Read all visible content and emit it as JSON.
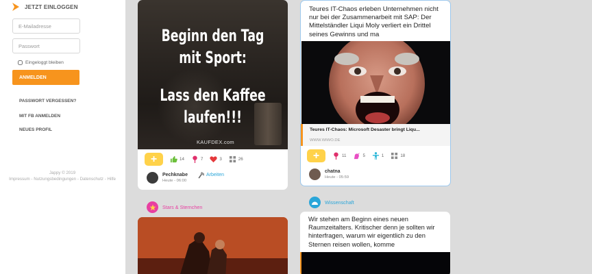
{
  "sidebar": {
    "login_title": "JETZT EINLOGGEN",
    "email_placeholder": "E-Mailadresse",
    "password_placeholder": "Passwort",
    "remember_label": "Eingeloggt bleiben",
    "login_button": "ANMELDEN",
    "links": {
      "forgot": "PASSWORT VERGESSEN?",
      "facebook": "MIT FB ANMELDEN",
      "new_profile": "NEUES PROFIL"
    },
    "footer": {
      "copyright": "Jappy © 2019",
      "links": "Impressum - Nutzungsbedingungen - Datenschutz - Hilfe"
    }
  },
  "feed": {
    "card1": {
      "quote_lines_1": [
        "Beginn den Tag",
        "mit Sport:"
      ],
      "quote_lines_2": [
        "Lass den Kaffee",
        "laufen!!!"
      ],
      "watermark": "KAUFDEX.com",
      "reactions": [
        {
          "icon": "thumbs-up-icon",
          "count": "14",
          "color": "#6bbf3a"
        },
        {
          "icon": "pin-icon",
          "count": "7",
          "color": "#e0306c"
        },
        {
          "icon": "heart-icon",
          "count": "3",
          "color": "#e5393c"
        },
        {
          "icon": "grid-icon",
          "count": "26",
          "color": "#8a8a8a"
        }
      ],
      "author": "Pechknabe",
      "time": "Heute - 06:00",
      "category": "Arbeiten"
    },
    "card2": {
      "text": "Teures IT-Chaos erleben Unternehmen nicht nur bei der Zusammenarbeit mit SAP: Der Mittelständler Liqui Moly verliert ein Drittel seines Gewinns und ma",
      "link_title": "Teures IT-Chaos: Microsoft Desaster bringt Liqu...",
      "link_domain": "WWW.WIWO.DE",
      "reactions": [
        {
          "icon": "pin-icon",
          "count": "11",
          "color": "#e0306c"
        },
        {
          "icon": "unicorn-icon",
          "count": "5",
          "color": "#e94fc4"
        },
        {
          "icon": "person-icon",
          "count": "1",
          "color": "#2ab6d8"
        },
        {
          "icon": "grid-icon",
          "count": "18",
          "color": "#8a8a8a"
        }
      ],
      "author": "chatna",
      "time": "Heute - 05:59"
    },
    "card3": {
      "category": "Stars & Sternchen",
      "category_color": "#e83fa1"
    },
    "card4": {
      "category": "Wissenschaft",
      "category_color": "#2aa6d9",
      "text": "Wir stehen am Beginn eines neuen Raumzeitalters. Kritischer denn je sollten wir hinterfragen, warum wir eigentlich zu den Sternen reisen wollen, komme"
    }
  },
  "colors": {
    "accent": "#f7941d",
    "plus_button": "#ffd24a"
  }
}
